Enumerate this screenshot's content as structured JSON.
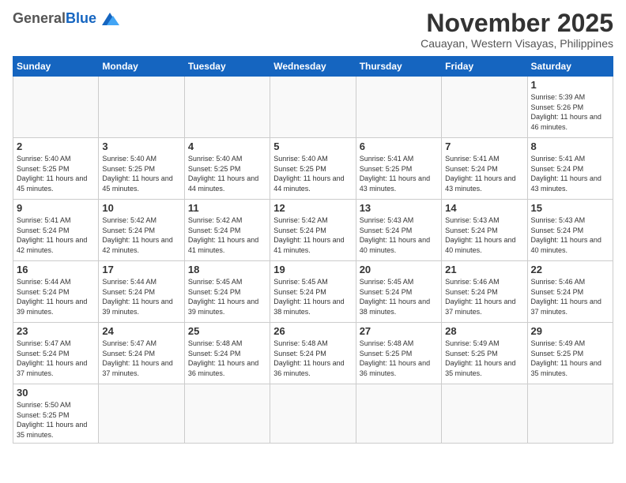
{
  "header": {
    "logo_general": "General",
    "logo_blue": "Blue",
    "month_title": "November 2025",
    "location": "Cauayan, Western Visayas, Philippines"
  },
  "weekdays": [
    "Sunday",
    "Monday",
    "Tuesday",
    "Wednesday",
    "Thursday",
    "Friday",
    "Saturday"
  ],
  "days": [
    {
      "date": "",
      "info": ""
    },
    {
      "date": "",
      "info": ""
    },
    {
      "date": "",
      "info": ""
    },
    {
      "date": "",
      "info": ""
    },
    {
      "date": "",
      "info": ""
    },
    {
      "date": "",
      "info": ""
    },
    {
      "date": "1",
      "sunrise": "5:39 AM",
      "sunset": "5:26 PM",
      "daylight": "11 hours and 46 minutes."
    },
    {
      "date": "2",
      "sunrise": "5:40 AM",
      "sunset": "5:25 PM",
      "daylight": "11 hours and 45 minutes."
    },
    {
      "date": "3",
      "sunrise": "5:40 AM",
      "sunset": "5:25 PM",
      "daylight": "11 hours and 45 minutes."
    },
    {
      "date": "4",
      "sunrise": "5:40 AM",
      "sunset": "5:25 PM",
      "daylight": "11 hours and 44 minutes."
    },
    {
      "date": "5",
      "sunrise": "5:40 AM",
      "sunset": "5:25 PM",
      "daylight": "11 hours and 44 minutes."
    },
    {
      "date": "6",
      "sunrise": "5:41 AM",
      "sunset": "5:25 PM",
      "daylight": "11 hours and 43 minutes."
    },
    {
      "date": "7",
      "sunrise": "5:41 AM",
      "sunset": "5:24 PM",
      "daylight": "11 hours and 43 minutes."
    },
    {
      "date": "8",
      "sunrise": "5:41 AM",
      "sunset": "5:24 PM",
      "daylight": "11 hours and 43 minutes."
    },
    {
      "date": "9",
      "sunrise": "5:41 AM",
      "sunset": "5:24 PM",
      "daylight": "11 hours and 42 minutes."
    },
    {
      "date": "10",
      "sunrise": "5:42 AM",
      "sunset": "5:24 PM",
      "daylight": "11 hours and 42 minutes."
    },
    {
      "date": "11",
      "sunrise": "5:42 AM",
      "sunset": "5:24 PM",
      "daylight": "11 hours and 41 minutes."
    },
    {
      "date": "12",
      "sunrise": "5:42 AM",
      "sunset": "5:24 PM",
      "daylight": "11 hours and 41 minutes."
    },
    {
      "date": "13",
      "sunrise": "5:43 AM",
      "sunset": "5:24 PM",
      "daylight": "11 hours and 40 minutes."
    },
    {
      "date": "14",
      "sunrise": "5:43 AM",
      "sunset": "5:24 PM",
      "daylight": "11 hours and 40 minutes."
    },
    {
      "date": "15",
      "sunrise": "5:43 AM",
      "sunset": "5:24 PM",
      "daylight": "11 hours and 40 minutes."
    },
    {
      "date": "16",
      "sunrise": "5:44 AM",
      "sunset": "5:24 PM",
      "daylight": "11 hours and 39 minutes."
    },
    {
      "date": "17",
      "sunrise": "5:44 AM",
      "sunset": "5:24 PM",
      "daylight": "11 hours and 39 minutes."
    },
    {
      "date": "18",
      "sunrise": "5:45 AM",
      "sunset": "5:24 PM",
      "daylight": "11 hours and 39 minutes."
    },
    {
      "date": "19",
      "sunrise": "5:45 AM",
      "sunset": "5:24 PM",
      "daylight": "11 hours and 38 minutes."
    },
    {
      "date": "20",
      "sunrise": "5:45 AM",
      "sunset": "5:24 PM",
      "daylight": "11 hours and 38 minutes."
    },
    {
      "date": "21",
      "sunrise": "5:46 AM",
      "sunset": "5:24 PM",
      "daylight": "11 hours and 37 minutes."
    },
    {
      "date": "22",
      "sunrise": "5:46 AM",
      "sunset": "5:24 PM",
      "daylight": "11 hours and 37 minutes."
    },
    {
      "date": "23",
      "sunrise": "5:47 AM",
      "sunset": "5:24 PM",
      "daylight": "11 hours and 37 minutes."
    },
    {
      "date": "24",
      "sunrise": "5:47 AM",
      "sunset": "5:24 PM",
      "daylight": "11 hours and 37 minutes."
    },
    {
      "date": "25",
      "sunrise": "5:48 AM",
      "sunset": "5:24 PM",
      "daylight": "11 hours and 36 minutes."
    },
    {
      "date": "26",
      "sunrise": "5:48 AM",
      "sunset": "5:24 PM",
      "daylight": "11 hours and 36 minutes."
    },
    {
      "date": "27",
      "sunrise": "5:48 AM",
      "sunset": "5:25 PM",
      "daylight": "11 hours and 36 minutes."
    },
    {
      "date": "28",
      "sunrise": "5:49 AM",
      "sunset": "5:25 PM",
      "daylight": "11 hours and 35 minutes."
    },
    {
      "date": "29",
      "sunrise": "5:49 AM",
      "sunset": "5:25 PM",
      "daylight": "11 hours and 35 minutes."
    },
    {
      "date": "30",
      "sunrise": "5:50 AM",
      "sunset": "5:25 PM",
      "daylight": "11 hours and 35 minutes."
    }
  ]
}
